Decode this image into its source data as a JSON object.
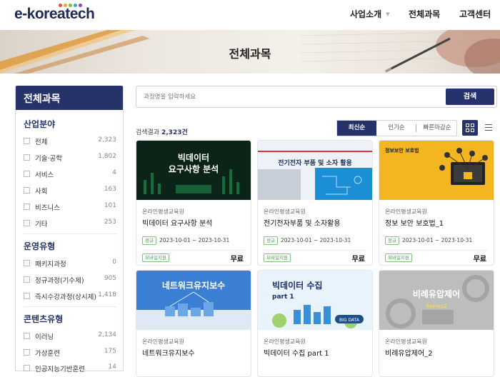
{
  "header": {
    "logo_text": "e-koreatech",
    "logo_dot_colors": [
      "#e94b3c",
      "#f5a623",
      "#7ac143",
      "#29abe2",
      "#8e44ad"
    ],
    "nav": [
      "사업소개",
      "전체과목",
      "고객센터"
    ]
  },
  "banner": {
    "title": "전체과목"
  },
  "sidebar": {
    "title": "전체과목",
    "sections": [
      {
        "title": "산업분야",
        "items": [
          {
            "label": "전체",
            "count": "2,323"
          },
          {
            "label": "기술·공학",
            "count": "1,802"
          },
          {
            "label": "서비스",
            "count": "4"
          },
          {
            "label": "사회",
            "count": "163"
          },
          {
            "label": "비즈니스",
            "count": "101"
          },
          {
            "label": "기타",
            "count": "253"
          }
        ]
      },
      {
        "title": "운영유형",
        "items": [
          {
            "label": "패키지과정",
            "count": "0"
          },
          {
            "label": "정규과정(기수제)",
            "count": "905"
          },
          {
            "label": "즉시수강과정(상시제)",
            "count": "1,418"
          }
        ]
      },
      {
        "title": "콘텐츠유형",
        "items": [
          {
            "label": "이러닝",
            "count": "2,134"
          },
          {
            "label": "가상훈련",
            "count": "175"
          },
          {
            "label": "인공지능기반훈련",
            "count": "14"
          }
        ]
      }
    ]
  },
  "search": {
    "placeholder": "과정명을 입력하세요",
    "button": "검색"
  },
  "results": {
    "prefix": "검색결과",
    "count": "2,323건"
  },
  "sort": {
    "options": [
      "최신순",
      "인기순",
      "빠른마감순"
    ],
    "active": "최신순"
  },
  "colors": {
    "primary": "#26336b",
    "tag_green": "#3c9b3b"
  },
  "cards": [
    {
      "thumb_text": "빅데이터\n요구사항 분석",
      "provider": "온라인평생교육원",
      "title": "빅데이터 요구사항 분석",
      "tag": "정규",
      "period": "2023-10-01 ~ 2023-10-31",
      "mobile": "모바일지원",
      "price": "무료"
    },
    {
      "thumb_text": "전기전자 부품 및 소자 활용",
      "provider": "온라인평생교육원",
      "title": "전기전자부품 및 소자활용",
      "tag": "정규",
      "period": "2023-10-01 ~ 2023-10-31",
      "mobile": "모바일지원",
      "price": "무료"
    },
    {
      "thumb_text": "정보보안 보호법",
      "provider": "온라인평생교육원",
      "title": "정보 보안 보호법_1",
      "tag": "정규",
      "period": "2023-10-01 ~ 2023-10-31",
      "mobile": "모바일지원",
      "price": "무료"
    },
    {
      "thumb_text": "네트워크유지보수",
      "provider": "온라인평생교육원",
      "title": "네트워크유지보수"
    },
    {
      "thumb_text": "빅데이터 수집\npart 1",
      "provider": "온라인평생교육원",
      "title": "빅데이터 수집 part 1"
    },
    {
      "thumb_text": "비례유압제어\nSeries2",
      "provider": "온라인평생교육원",
      "title": "비례유압제어_2"
    }
  ]
}
